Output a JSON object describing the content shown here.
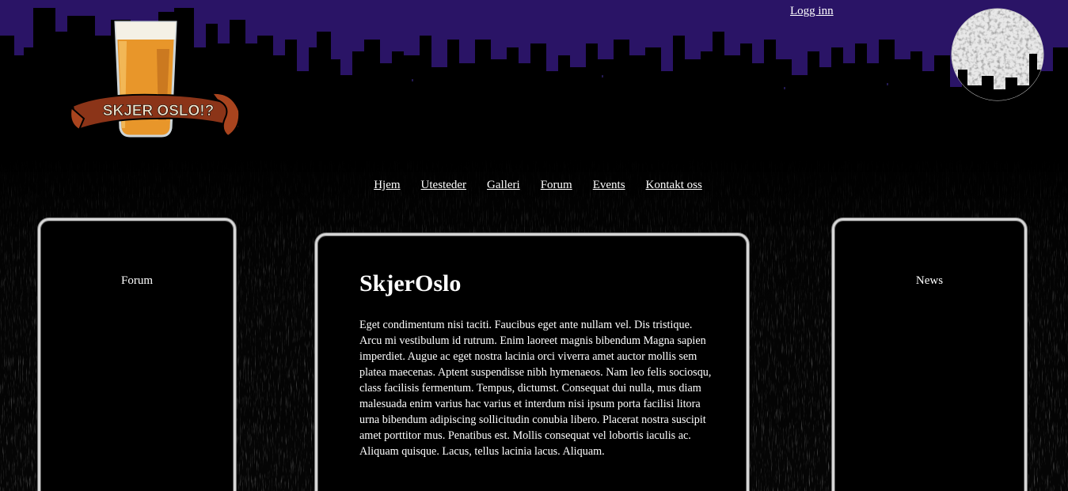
{
  "header": {
    "login_label": "Logg inn",
    "logo_text": "SKJER OSLO!?"
  },
  "nav": {
    "items": [
      {
        "label": "Hjem"
      },
      {
        "label": "Utesteder"
      },
      {
        "label": "Galleri"
      },
      {
        "label": "Forum"
      },
      {
        "label": "Events"
      },
      {
        "label": "Kontakt oss"
      }
    ]
  },
  "left_panel": {
    "title": "Forum"
  },
  "right_panel": {
    "title": "News"
  },
  "main": {
    "heading": "SkjerOslo",
    "body": "Eget condimentum nisi taciti. Faucibus eget ante nullam vel. Dis tristique. Arcu mi vestibulum id rutrum. Enim laoreet magnis bibendum Magna sapien imperdiet. Augue ac eget nostra lacinia orci viverra amet auctor mollis sem platea maecenas. Aptent suspendisse nibh hymenaeos. Nam leo felis sociosqu, class facilisis fermentum. Tempus, dictumst. Consequat dui nulla, mus diam malesuada enim varius hac varius et interdum nisi ipsum porta facilisi litora urna bibendum adipiscing sollicitudin conubia libero. Placerat nostra suscipit amet porttitor mus. Penatibus est. Mollis consequat vel lobortis iaculis ac. Aliquam quisque. Lacus, tellus lacinia lacus. Aliquam."
  },
  "colors": {
    "sky": "#2a1466",
    "skyline": "#000000",
    "panel_border": "#d6d6d6",
    "beer": "#e8962a"
  }
}
